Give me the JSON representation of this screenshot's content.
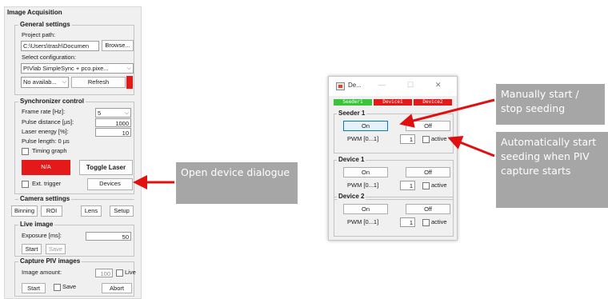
{
  "panel": {
    "title": "Image Acquisition",
    "general": {
      "title": "General settings",
      "project_path_label": "Project path:",
      "project_path_value": "C:\\Users\\trash\\Documen",
      "browse": "Browse...",
      "select_config_label": "Select configuration:",
      "config_value": "PIVlab SimpleSync + pco.pixe...",
      "port_value": "No availab...",
      "refresh": "Refresh"
    },
    "sync": {
      "title": "Synchronizer control",
      "frame_rate_label": "Frame rate [Hz]:",
      "frame_rate_value": "5",
      "pulse_distance_label": "Pulse distance [µs]:",
      "pulse_distance_value": "1000",
      "laser_energy_label": "Laser energy [%]:",
      "laser_energy_value": "10",
      "pulse_length_label": "Pulse length: 0 µs",
      "timing_graph": "Timing graph",
      "status_btn": "N/A",
      "toggle_laser": "Toggle Laser",
      "ext_trigger": "Ext. trigger",
      "devices": "Devices"
    },
    "camera": {
      "title": "Camera settings",
      "binning": "Binning",
      "roi": "ROI",
      "lens": "Lens",
      "setup": "Setup"
    },
    "live": {
      "title": "Live image",
      "exposure_label": "Exposure [ms]:",
      "exposure_value": "50",
      "start": "Start",
      "save": "Save"
    },
    "capture": {
      "title": "Capture PIV images",
      "amount_label": "Image amount:",
      "amount_value": "100",
      "live": "Live",
      "start": "Start",
      "save": "Save",
      "abort": "Abort"
    }
  },
  "dialog": {
    "title": "De...",
    "minimize": "—",
    "maximize": "☐",
    "close": "✕",
    "status": [
      "Seeder1",
      "Device1",
      "Device2"
    ],
    "status_colors": [
      "#3ac43a",
      "#e41a1a",
      "#e41a1a"
    ],
    "groups": [
      {
        "title": "Seeder 1",
        "on": "On",
        "off": "Off",
        "pwm_label": "PWM [0...1]",
        "pwm_value": "1",
        "active": "active"
      },
      {
        "title": "Device 1",
        "on": "On",
        "off": "Off",
        "pwm_label": "PWM [0...1]",
        "pwm_value": "1",
        "active": "active"
      },
      {
        "title": "Device 2",
        "on": "On",
        "off": "Off",
        "pwm_label": "PWM [0...1]",
        "pwm_value": "1",
        "active": "active"
      }
    ]
  },
  "callouts": {
    "open_device": "Open device dialogue",
    "manual_seeding": "Manually start / stop seeding",
    "auto_seeding": "Automatically start seeding when PIV capture starts"
  },
  "colors": {
    "callout_bg": "#a6a6a6",
    "arrow": "#e01010",
    "status_on": "#3ac43a",
    "status_off": "#e41a1a"
  }
}
